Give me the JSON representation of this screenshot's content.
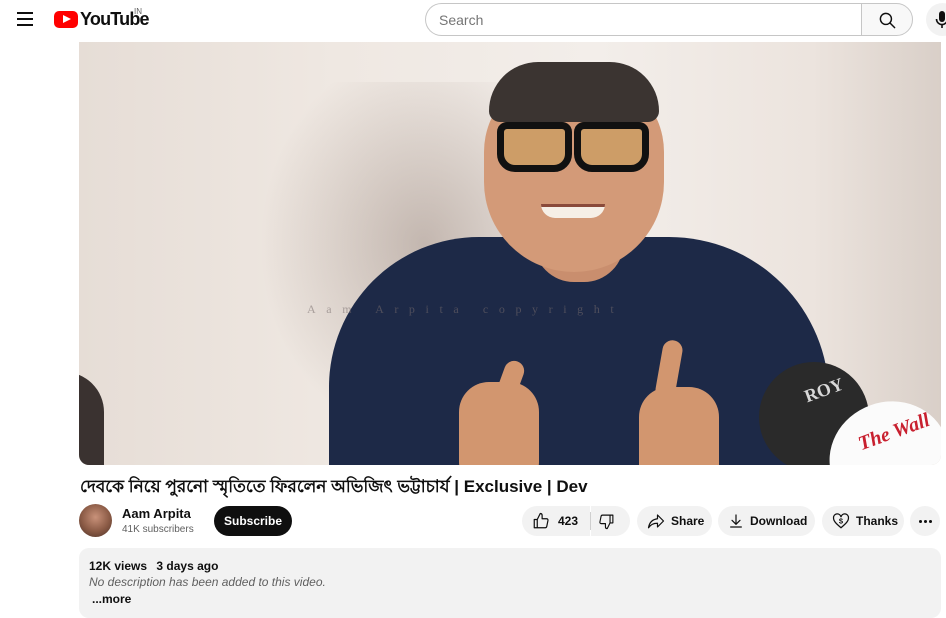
{
  "masthead": {
    "logo_text": "YouTube",
    "country_code": "IN",
    "search_placeholder": "Search",
    "icons": [
      "menu-icon",
      "youtube-logo-icon",
      "search-icon",
      "microphone-icon"
    ]
  },
  "player": {
    "watermark": "Aam Arpita copyright",
    "mic_flag_dark": "ROY",
    "mic_flag_white": "The Wall"
  },
  "video": {
    "title": "দেবকে নিয়ে পুরনো স্মৃতিতে ফিরলেন অভিজিৎ ভট্টাচার্য | Exclusive | Dev"
  },
  "owner": {
    "channel_name": "Aam Arpita",
    "subscribers": "41K subscribers",
    "subscribe_label": "Subscribe"
  },
  "actions": {
    "like_count": "423",
    "share_label": "Share",
    "download_label": "Download",
    "thanks_label": "Thanks",
    "icons": [
      "thumbs-up-icon",
      "thumbs-down-icon",
      "share-icon",
      "download-icon",
      "thanks-icon",
      "more-icon"
    ]
  },
  "description": {
    "views": "12K views",
    "date": "3 days ago",
    "text": "No description has been added to this video.",
    "more_label": "...more"
  },
  "colors": {
    "brand_red": "#ff0000",
    "text_primary": "#0f0f0f",
    "text_secondary": "#606060",
    "chip_bg": "#f2f2f2",
    "subscribe_bg": "#0f0f0f"
  }
}
